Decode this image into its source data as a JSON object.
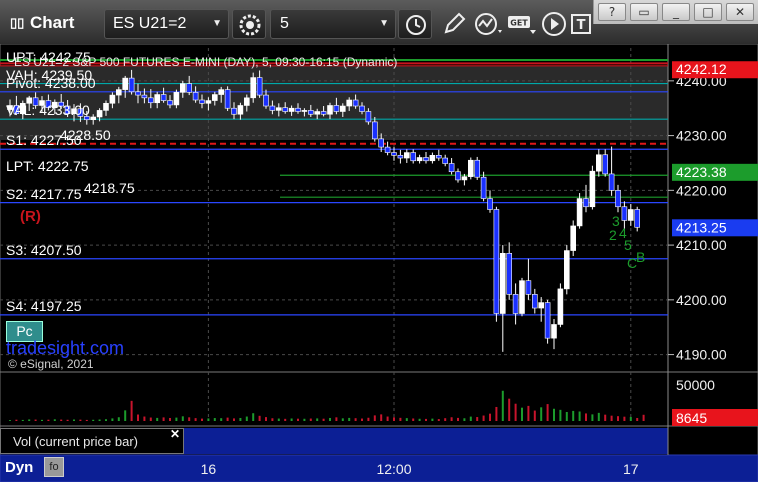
{
  "window": {
    "title": "Chart",
    "controls": [
      "?",
      "restore",
      "minimize",
      "maximize",
      "close"
    ]
  },
  "toolbar": {
    "symbol_value": "ES U21=2",
    "interval_value": "5",
    "icons": [
      "settings-icon",
      "clock-icon",
      "pencil-icon",
      "indicator-icon",
      "get-icon",
      "play-icon",
      "text-icon"
    ]
  },
  "chart": {
    "title_line": "ES U21=2  S&P 500 FUTURES E-MINI (DAY), 5, 09:30-16:15 (Dynamic)",
    "levels": [
      {
        "label": "UPT: 4242.75",
        "value": 4242.75
      },
      {
        "label": "VAH: 4239.50",
        "value": 4239.5
      },
      {
        "label": "Pivot: 4238.00",
        "value": 4238.0
      },
      {
        "label": "VAL: 4233.00",
        "value": 4233.0
      },
      {
        "label": "4228.50",
        "value": 4228.5
      },
      {
        "label": "S1: 4227.50",
        "value": 4227.5
      },
      {
        "label": "LPT: 4222.75",
        "value": 4222.75
      },
      {
        "label": "4218.75",
        "value": 4218.75
      },
      {
        "label": "S2: 4217.75",
        "value": 4217.75
      },
      {
        "label": "S3: 4207.50",
        "value": 4207.5
      },
      {
        "label": "S4: 4197.25",
        "value": 4197.25
      }
    ],
    "marker_r": "(R)",
    "pc_button": "Pc",
    "watermark": "tradesight.com",
    "copyright": "© eSignal, 2021",
    "price_axis": [
      "4240.00",
      "4230.00",
      "4220.00",
      "4210.00",
      "4200.00",
      "4190.00"
    ],
    "price_tags": [
      {
        "label": "4242.12",
        "bg": "#e8141c",
        "fg": "#ffffff"
      },
      {
        "label": "4223.38",
        "bg": "#1c9c2c",
        "fg": "#ffffff"
      },
      {
        "label": "4213.25",
        "bg": "#1a3cf0",
        "fg": "#ffffff"
      }
    ],
    "tag_values": [
      4242.12,
      4223.38,
      4213.25
    ],
    "wave_labels": [
      "3",
      "2",
      "4",
      "5",
      "C",
      "B"
    ],
    "price_range": [
      4187,
      4246
    ],
    "candles": [
      [
        4234.75,
        4236.6,
        4233.5,
        4235.5
      ],
      [
        4235.5,
        4237.25,
        4233.75,
        4234.0
      ],
      [
        4234.0,
        4236.4,
        4233.0,
        4235.9
      ],
      [
        4235.9,
        4237.25,
        4234.5,
        4236.9
      ],
      [
        4236.9,
        4237.9,
        4234.9,
        4235.5
      ],
      [
        4235.5,
        4237.2,
        4234.2,
        4236.4
      ],
      [
        4236.4,
        4237.5,
        4234.6,
        4235.1
      ],
      [
        4235.1,
        4236.6,
        4233.9,
        4236.1
      ],
      [
        4236.1,
        4237.6,
        4234.9,
        4235.4
      ],
      [
        4235.4,
        4236.5,
        4233.4,
        4234.0
      ],
      [
        4234.0,
        4235.75,
        4232.6,
        4234.9
      ],
      [
        4234.9,
        4235.9,
        4232.5,
        4233.5
      ],
      [
        4233.5,
        4234.5,
        4232.0,
        4232.9
      ],
      [
        4232.9,
        4233.9,
        4232.0,
        4233.4
      ],
      [
        4233.4,
        4235.0,
        4232.6,
        4234.6
      ],
      [
        4234.6,
        4236.4,
        4233.6,
        4235.9
      ],
      [
        4235.9,
        4237.9,
        4235.0,
        4237.4
      ],
      [
        4237.4,
        4238.9,
        4235.9,
        4238.4
      ],
      [
        4238.4,
        4240.9,
        4236.9,
        4240.5
      ],
      [
        4240.5,
        4242.0,
        4237.5,
        4238.0
      ],
      [
        4238.0,
        4239.5,
        4235.9,
        4237.4
      ],
      [
        4237.4,
        4238.6,
        4235.9,
        4236.9
      ],
      [
        4236.9,
        4238.5,
        4235.0,
        4236.0
      ],
      [
        4236.0,
        4238.0,
        4235.0,
        4237.5
      ],
      [
        4237.5,
        4238.75,
        4236.0,
        4236.4
      ],
      [
        4236.4,
        4237.4,
        4235.0,
        4235.6
      ],
      [
        4235.6,
        4238.4,
        4235.0,
        4237.9
      ],
      [
        4237.9,
        4240.0,
        4236.9,
        4239.5
      ],
      [
        4239.5,
        4240.9,
        4237.4,
        4237.9
      ],
      [
        4237.9,
        4239.0,
        4236.0,
        4236.5
      ],
      [
        4236.5,
        4237.5,
        4235.0,
        4235.9
      ],
      [
        4235.9,
        4237.0,
        4234.6,
        4236.4
      ],
      [
        4236.4,
        4238.0,
        4235.5,
        4237.5
      ],
      [
        4237.5,
        4238.9,
        4236.0,
        4238.4
      ],
      [
        4238.4,
        4239.0,
        4234.5,
        4235.0
      ],
      [
        4235.0,
        4236.1,
        4233.0,
        4233.9
      ],
      [
        4233.9,
        4236.0,
        4232.9,
        4235.5
      ],
      [
        4235.5,
        4237.5,
        4234.4,
        4236.9
      ],
      [
        4236.9,
        4241.5,
        4236.0,
        4240.6
      ],
      [
        4240.6,
        4241.9,
        4236.9,
        4237.4
      ],
      [
        4237.4,
        4238.4,
        4234.9,
        4235.4
      ],
      [
        4235.4,
        4236.4,
        4233.9,
        4234.6
      ],
      [
        4234.6,
        4235.9,
        4233.5,
        4235.1
      ],
      [
        4235.1,
        4236.1,
        4234.0,
        4234.4
      ],
      [
        4234.4,
        4235.5,
        4233.6,
        4235.0
      ],
      [
        4235.0,
        4235.9,
        4234.0,
        4234.4
      ],
      [
        4234.4,
        4235.0,
        4233.5,
        4234.6
      ],
      [
        4234.6,
        4235.6,
        4233.4,
        4233.9
      ],
      [
        4233.9,
        4234.9,
        4233.0,
        4234.4
      ],
      [
        4234.4,
        4235.4,
        4233.5,
        4233.9
      ],
      [
        4233.9,
        4236.0,
        4233.0,
        4235.5
      ],
      [
        4235.5,
        4236.9,
        4233.9,
        4234.4
      ],
      [
        4234.4,
        4235.9,
        4233.4,
        4235.4
      ],
      [
        4235.4,
        4237.0,
        4234.5,
        4236.5
      ],
      [
        4236.5,
        4237.5,
        4234.9,
        4235.4
      ],
      [
        4235.4,
        4236.1,
        4233.9,
        4234.4
      ],
      [
        4234.4,
        4235.0,
        4232.0,
        4232.5
      ],
      [
        4232.5,
        4233.4,
        4228.9,
        4229.4
      ],
      [
        4229.4,
        4230.4,
        4227.0,
        4227.9
      ],
      [
        4227.9,
        4228.9,
        4226.4,
        4226.9
      ],
      [
        4226.9,
        4227.9,
        4225.4,
        4226.4
      ],
      [
        4226.4,
        4227.4,
        4224.9,
        4225.9
      ],
      [
        4225.9,
        4227.5,
        4225.0,
        4226.9
      ],
      [
        4226.9,
        4227.5,
        4224.9,
        4225.4
      ],
      [
        4225.4,
        4226.5,
        4224.9,
        4226.0
      ],
      [
        4226.0,
        4227.0,
        4224.9,
        4225.4
      ],
      [
        4225.4,
        4226.9,
        4224.9,
        4226.4
      ],
      [
        4226.4,
        4227.4,
        4225.4,
        4225.9
      ],
      [
        4225.9,
        4226.5,
        4224.4,
        4224.9
      ],
      [
        4224.9,
        4225.9,
        4222.9,
        4223.4
      ],
      [
        4223.4,
        4224.0,
        4221.4,
        4221.9
      ],
      [
        4221.9,
        4223.0,
        4220.9,
        4222.5
      ],
      [
        4222.5,
        4226.0,
        4222.0,
        4225.5
      ],
      [
        4225.5,
        4226.1,
        4221.9,
        4222.4
      ],
      [
        4222.4,
        4223.4,
        4218.0,
        4218.5
      ],
      [
        4218.5,
        4220.0,
        4215.9,
        4216.5
      ],
      [
        4216.5,
        4217.0,
        4196.0,
        4197.5
      ],
      [
        4197.5,
        4210.0,
        4190.5,
        4208.5
      ],
      [
        4208.5,
        4210.5,
        4200.0,
        4201.0
      ],
      [
        4201.0,
        4203.0,
        4195.5,
        4197.5
      ],
      [
        4197.5,
        4204.0,
        4197.0,
        4203.5
      ],
      [
        4203.5,
        4207.5,
        4200.0,
        4201.0
      ],
      [
        4201.0,
        4202.0,
        4197.5,
        4198.5
      ],
      [
        4198.5,
        4200.5,
        4196.0,
        4199.5
      ],
      [
        4199.5,
        4200.0,
        4192.0,
        4193.0
      ],
      [
        4193.0,
        4196.5,
        4191.0,
        4195.5
      ],
      [
        4195.5,
        4203.0,
        4195.0,
        4202.0
      ],
      [
        4202.0,
        4210.0,
        4201.0,
        4209.0
      ],
      [
        4209.0,
        4214.5,
        4208.0,
        4213.5
      ],
      [
        4213.5,
        4219.5,
        4213.0,
        4218.5
      ],
      [
        4218.5,
        4221.0,
        4216.0,
        4217.0
      ],
      [
        4217.0,
        4224.5,
        4216.5,
        4223.5
      ],
      [
        4223.5,
        4227.5,
        4222.5,
        4226.5
      ],
      [
        4226.5,
        4227.5,
        4222.5,
        4223.0
      ],
      [
        4223.0,
        4228.0,
        4219.0,
        4220.0
      ],
      [
        4220.0,
        4221.0,
        4216.0,
        4217.0
      ],
      [
        4217.0,
        4218.0,
        4213.0,
        4214.5
      ],
      [
        4214.5,
        4217.5,
        4213.5,
        4216.5
      ],
      [
        4216.5,
        4217.0,
        4212.5,
        4213.25
      ]
    ],
    "time_labels": [
      {
        "label": "16",
        "bar": 31
      },
      {
        "label": "12:00",
        "bar": 60
      },
      {
        "label": "17",
        "bar": 97
      }
    ]
  },
  "volume": {
    "axis_label": "50000",
    "current_label": "8645",
    "current_value": 8645,
    "axis_value": 50000,
    "legend": "Vol (current price bar)",
    "values": [
      1200,
      1800,
      1500,
      2200,
      2000,
      1600,
      1800,
      2400,
      2000,
      1700,
      2100,
      1900,
      1500,
      1700,
      2100,
      2500,
      3600,
      5200,
      14800,
      28000,
      9000,
      6200,
      4800,
      4300,
      5000,
      4200,
      4700,
      6500,
      5100,
      4000,
      3300,
      3600,
      4100,
      3900,
      4700,
      3600,
      4200,
      6200,
      10800,
      7200,
      5400,
      3800,
      3400,
      3000,
      3500,
      3200,
      3100,
      3400,
      3600,
      3200,
      4200,
      5100,
      3700,
      4300,
      3900,
      3400,
      4500,
      7800,
      9200,
      6200,
      5100,
      4400,
      4000,
      3500,
      3100,
      2900,
      3300,
      2700,
      3900,
      5200,
      4300,
      3800,
      6100,
      5500,
      7600,
      10200,
      19500,
      42000,
      31000,
      24000,
      18500,
      21000,
      14500,
      19000,
      23500,
      17000,
      15500,
      12500,
      14000,
      13200,
      10500,
      9200,
      11300,
      8800,
      7400,
      6700,
      6000,
      5600,
      4200,
      8645
    ],
    "up_color": "#1c9c2c",
    "down_color": "#c8142c"
  },
  "bottom": {
    "dyn_label": "Dyn"
  }
}
